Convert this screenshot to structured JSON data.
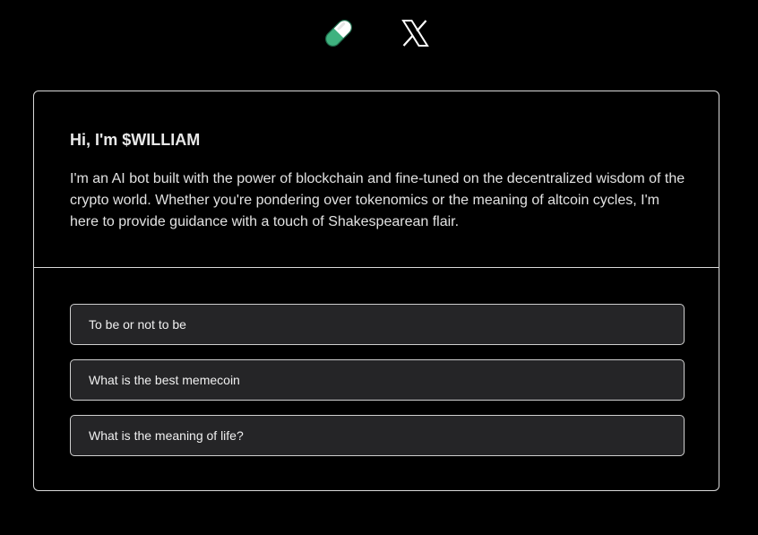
{
  "header": {
    "icons": [
      {
        "name": "pill-icon",
        "colors": {
          "top": "#ffffff",
          "bottom": "#3fb27f"
        }
      },
      {
        "name": "x-logo-icon"
      }
    ]
  },
  "intro": {
    "title": "Hi, I'm $WILLIAM",
    "description": "I'm an AI bot built with the power of blockchain and fine-tuned on the decentralized wisdom of the crypto world. Whether you're pondering over tokenomics or the meaning of altcoin cycles, I'm here to provide guidance with a touch of Shakespearean flair."
  },
  "prompts": [
    {
      "label": "To be or not to be"
    },
    {
      "label": "What is the best memecoin"
    },
    {
      "label": "What is the meaning of life?"
    }
  ],
  "colors": {
    "background": "#000000",
    "border": "#d9d9d9",
    "prompt_bg": "#252527",
    "accent": "#3fb27f"
  }
}
